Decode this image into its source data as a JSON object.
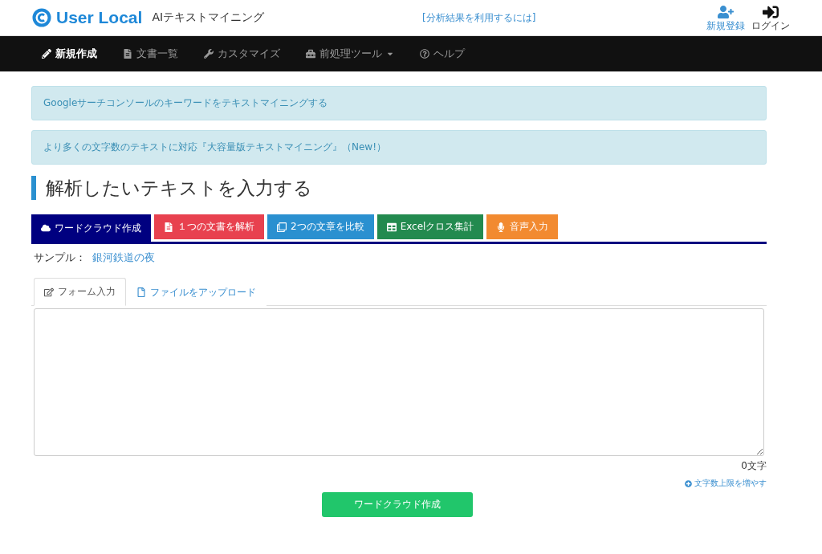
{
  "header": {
    "logo_text": "User Local",
    "product": "AIテキストマイニング",
    "center_link": "[分析結果を利用するには]",
    "actions": [
      {
        "label": "新規登録"
      },
      {
        "label": "ログイン"
      }
    ]
  },
  "nav": [
    {
      "label": "新規作成",
      "selected": true
    },
    {
      "label": "文書一覧",
      "selected": false
    },
    {
      "label": "カスタマイズ",
      "selected": false
    },
    {
      "label": "前処理ツール",
      "selected": false
    },
    {
      "label": "ヘルプ",
      "selected": false
    }
  ],
  "alerts": [
    "Googleサーチコンソールのキーワードをテキストマイニングする",
    "より多くの文字数のテキストに対応『大容量版テキストマイニング』（New!）"
  ],
  "heading": "解析したいテキストを入力する",
  "tools": [
    {
      "label": "ワードクラウド作成",
      "color": "#000080",
      "selected": true
    },
    {
      "label": "１つの文書を解析",
      "color": "#e8414f",
      "selected": false
    },
    {
      "label": "2つの文章を比較",
      "color": "#2a90d0",
      "selected": false
    },
    {
      "label": "Excelクロス集計",
      "color": "#238a4f",
      "selected": false
    },
    {
      "label": "音声入力",
      "color": "#f28a30",
      "selected": false
    }
  ],
  "sample": {
    "label": "サンプル：",
    "link": "銀河鉄道の夜"
  },
  "input_tabs": [
    {
      "label": "フォーム入力",
      "selected": true
    },
    {
      "label": "ファイルをアップロード",
      "selected": false
    }
  ],
  "char_count": "0文字",
  "increase_link": "文字数上限を増やす",
  "submit": "ワードクラウド作成"
}
